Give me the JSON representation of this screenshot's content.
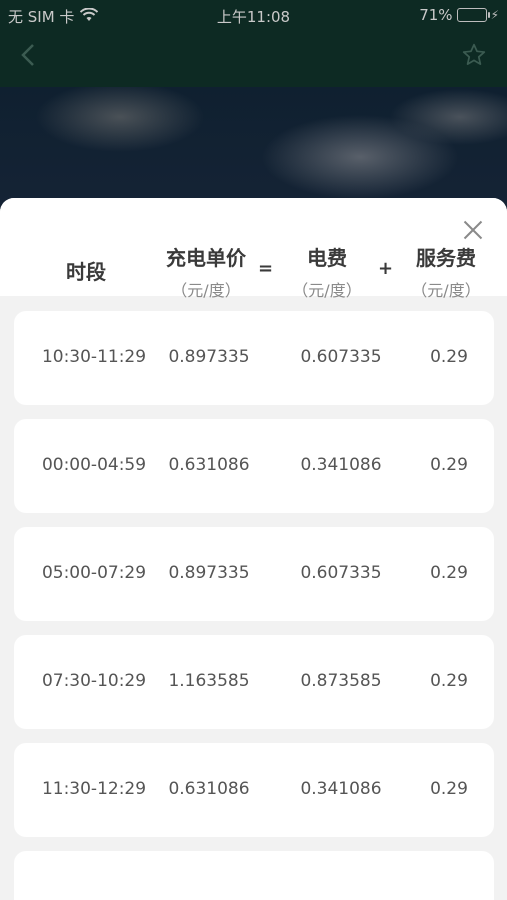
{
  "status_bar": {
    "carrier": "无 SIM 卡",
    "time": "上午11:08",
    "battery": "71%",
    "battery_level": 0.71
  },
  "header": {
    "col_time": "时段",
    "col_price": "充电单价",
    "col_price_unit": "（元/度）",
    "op_equals": "=",
    "col_elec": "电费",
    "col_elec_unit": "（元/度）",
    "op_plus": "+",
    "col_service": "服务费",
    "col_service_unit": "（元/度）"
  },
  "rows": [
    {
      "time": "10:30-11:29",
      "price": "0.897335",
      "elec": "0.607335",
      "service": "0.29"
    },
    {
      "time": "00:00-04:59",
      "price": "0.631086",
      "elec": "0.341086",
      "service": "0.29"
    },
    {
      "time": "05:00-07:29",
      "price": "0.897335",
      "elec": "0.607335",
      "service": "0.29"
    },
    {
      "time": "07:30-10:29",
      "price": "1.163585",
      "elec": "0.873585",
      "service": "0.29"
    },
    {
      "time": "11:30-12:29",
      "price": "0.631086",
      "elec": "0.341086",
      "service": "0.29"
    }
  ],
  "icons": {
    "back": "chevron-left-icon",
    "favorite": "star-outline-icon",
    "close": "close-icon",
    "wifi": "wifi-icon",
    "battery": "battery-icon"
  },
  "colors": {
    "nav_bg": "#0d2a23",
    "sheet_bg": "#f2f2f2",
    "card_bg": "#ffffff",
    "battery_green": "#4cd964"
  }
}
